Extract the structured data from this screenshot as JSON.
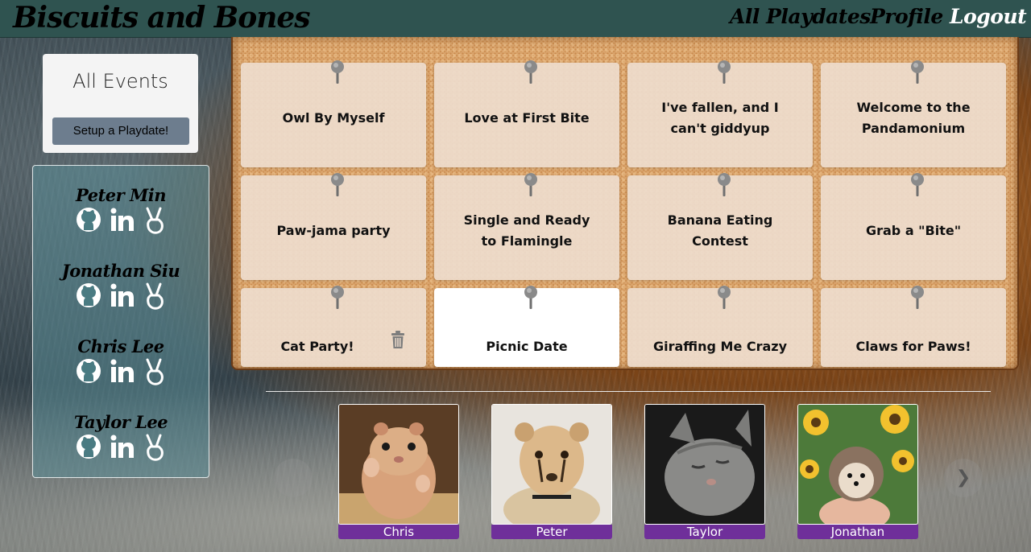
{
  "header": {
    "brand": "Biscuits and Bones",
    "nav": [
      {
        "label": "All Playdates"
      },
      {
        "label": "Profile"
      },
      {
        "label": "Logout"
      }
    ]
  },
  "sidebar": {
    "title": "All Events",
    "setup_button": "Setup a Playdate!",
    "team": [
      {
        "name": "Peter Min",
        "icons": [
          "github-icon",
          "linkedin-icon",
          "peace-hand-icon"
        ]
      },
      {
        "name": "Jonathan Siu",
        "icons": [
          "github-icon",
          "linkedin-icon",
          "peace-hand-icon"
        ]
      },
      {
        "name": "Chris Lee",
        "icons": [
          "github-icon",
          "linkedin-icon",
          "peace-hand-icon"
        ]
      },
      {
        "name": "Taylor Lee",
        "icons": [
          "github-icon",
          "linkedin-icon",
          "peace-hand-icon"
        ]
      }
    ]
  },
  "board": {
    "events": [
      {
        "line1": "Owl By Myself",
        "line2": ""
      },
      {
        "line1": "Love at First Bite",
        "line2": ""
      },
      {
        "line1": "I've fallen, and I",
        "line2": "can't giddyup"
      },
      {
        "line1": "Welcome to the",
        "line2": "Pandamonium"
      },
      {
        "line1": "Paw-jama party",
        "line2": ""
      },
      {
        "line1": "Single and Ready",
        "line2": "to Flamingle"
      },
      {
        "line1": "Banana Eating",
        "line2": "Contest"
      },
      {
        "line1": "Grab a \"Bite\"",
        "line2": ""
      },
      {
        "line1": "Cat Party!",
        "line2": "",
        "deletable": true
      },
      {
        "line1": "Picnic Date",
        "line2": "",
        "highlighted": true
      },
      {
        "line1": "Giraffing Me Crazy",
        "line2": ""
      },
      {
        "line1": "Claws for Paws!",
        "line2": ""
      }
    ]
  },
  "carousel": {
    "prev_icon": "chevron-left-icon",
    "next_icon": "chevron-right-icon",
    "next_glyph": "❯",
    "pets": [
      {
        "name": "Chris",
        "photo": "hamster"
      },
      {
        "name": "Peter",
        "photo": "cheetah-cub"
      },
      {
        "name": "Taylor",
        "photo": "gray-kitten"
      },
      {
        "name": "Jonathan",
        "photo": "hedgehog-sunflowers"
      }
    ]
  },
  "colors": {
    "navbar": "#2f5350",
    "button": "#6d7d8e",
    "pet_label": "#6f2f9a"
  }
}
